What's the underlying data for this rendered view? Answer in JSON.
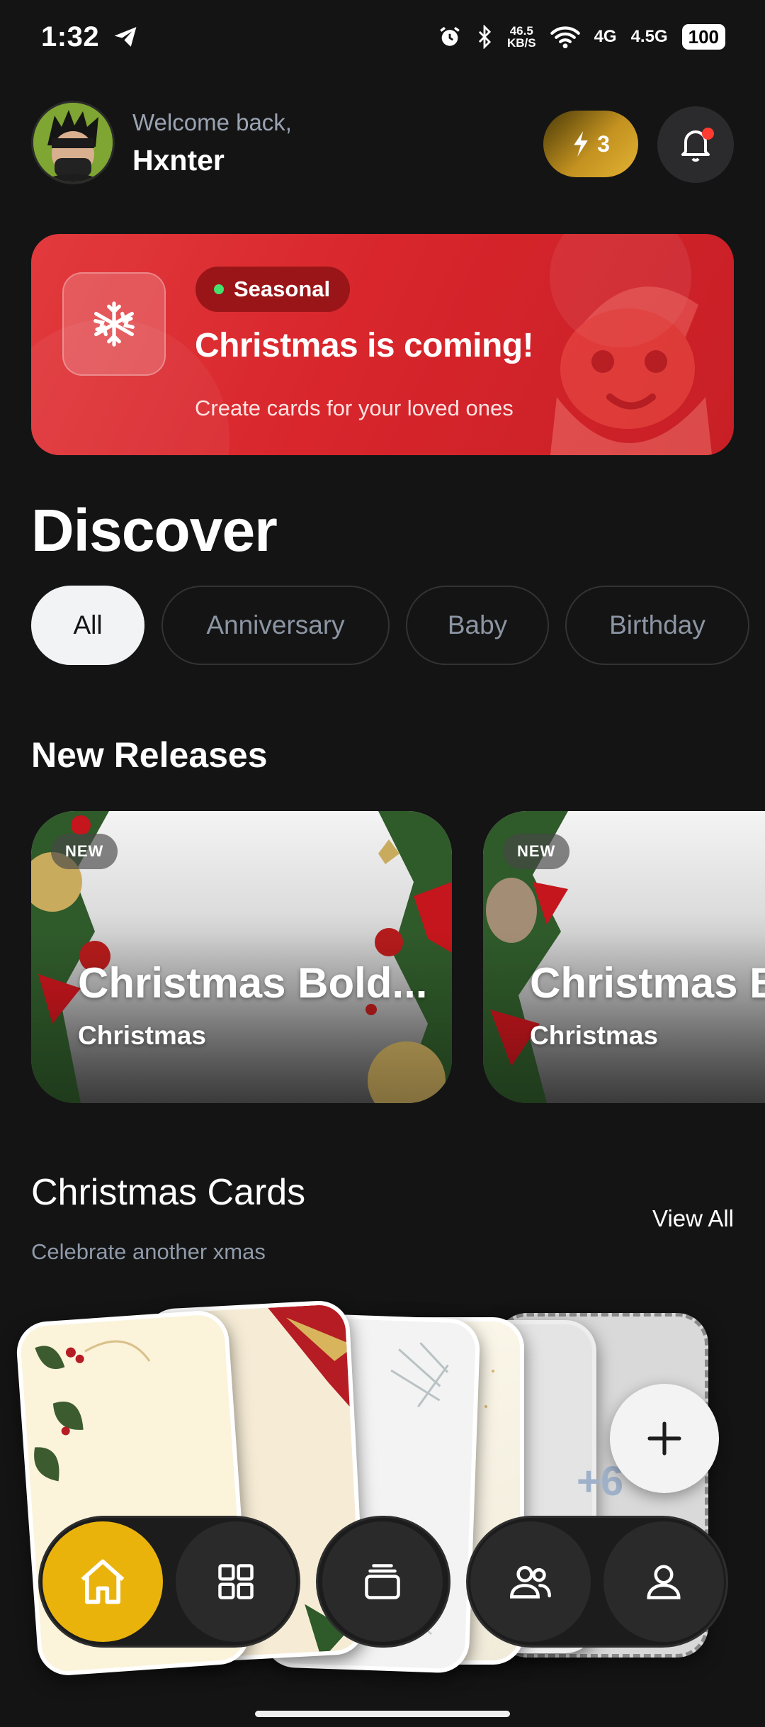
{
  "status_bar": {
    "time": "1:32",
    "net_speed_value": "46.5",
    "net_speed_unit": "KB/S",
    "signal1": "4G",
    "signal2": "4.5G",
    "battery": "100"
  },
  "header": {
    "welcome": "Welcome back,",
    "username": "Hxnter",
    "energy_count": "3"
  },
  "banner": {
    "chip_label": "Seasonal",
    "title": "Christmas is coming!",
    "subtitle": "Create cards for your loved ones",
    "color": "#d8262c"
  },
  "discover_title": "Discover",
  "filters": [
    "All",
    "Anniversary",
    "Baby",
    "Birthday"
  ],
  "new_releases": {
    "title": "New Releases",
    "cards": [
      {
        "badge": "NEW",
        "title": "Christmas Bold...",
        "category": "Christmas"
      },
      {
        "badge": "NEW",
        "title": "Christmas B",
        "category": "Christmas"
      }
    ]
  },
  "christmas_cards": {
    "title": "Christmas Cards",
    "subtitle": "Celebrate another xmas",
    "view_all": "View All",
    "more_count": "+6"
  },
  "bottom_nav": {
    "items": [
      "home-icon",
      "grid-icon",
      "cards-icon",
      "people-icon",
      "profile-icon"
    ],
    "accent": "#e9b30c"
  }
}
